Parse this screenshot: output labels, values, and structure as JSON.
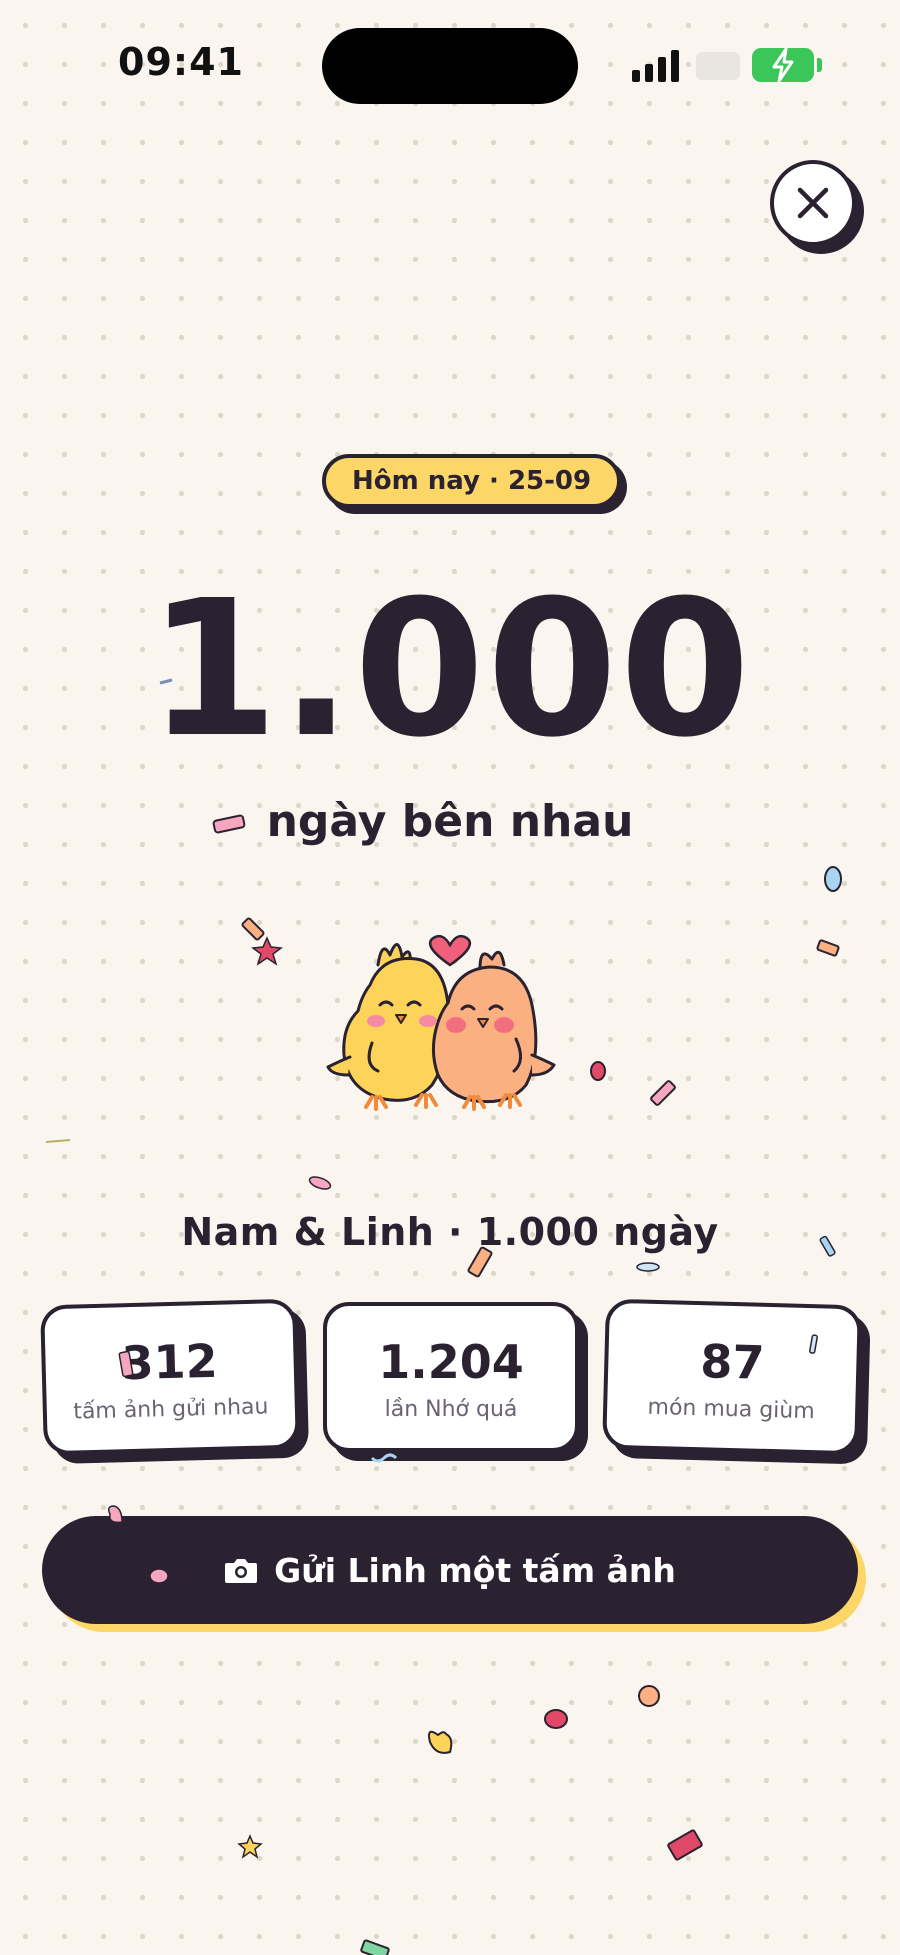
{
  "status_bar": {
    "time": "09:41"
  },
  "header": {
    "date_label": "Hôm nay · 25-09"
  },
  "milestone": {
    "number": "1.000",
    "subtitle": "ngày bên nhau"
  },
  "couple": {
    "caption": "Nam & Linh · 1.000 ngày"
  },
  "stats": [
    {
      "value": "312",
      "label": "tấm ảnh gửi nhau"
    },
    {
      "value": "1.204",
      "label": "lần Nhớ quá"
    },
    {
      "value": "87",
      "label": "món mua giùm"
    }
  ],
  "cta": {
    "label": "Gửi Linh một tấm ảnh",
    "icon": "camera-icon"
  },
  "icons": {
    "close": "close-icon",
    "mascot": "chick-couple-illustration"
  },
  "colors": {
    "background": "#faf6ef",
    "ink": "#2a2230",
    "accent_yellow": "#fcd767",
    "chick_yellow": "#fdd35a",
    "chick_peach": "#fbb082",
    "heart": "#f0607a",
    "battery_green": "#3cc65a"
  }
}
